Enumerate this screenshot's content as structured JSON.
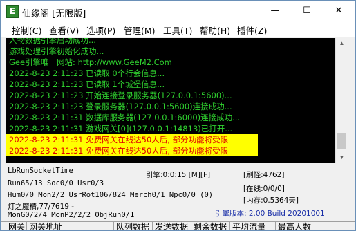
{
  "window": {
    "title": "仙缘阁 [无限版]",
    "icon_letter": "E"
  },
  "titlebar_buttons": {
    "minimize": "—",
    "maximize": "☐",
    "close": "✕"
  },
  "menu": [
    "控制(C)",
    "查看(V)",
    "选项(P)",
    "管理(M)",
    "工具(T)",
    "帮助(H)",
    "插件(Z)"
  ],
  "colors": {
    "green": "#2fd12f",
    "yellow_bg": "#ffff00",
    "red_text": "#e00000"
  },
  "log": [
    {
      "text": "人物数据引擎启动成功...",
      "style": "green"
    },
    {
      "text": "游戏处理引擎初始化成功...",
      "style": "green"
    },
    {
      "text": "Gee引擎唯一网站: http://www.GeeM2.Com",
      "style": "green"
    },
    {
      "text": "2022-8-23 2:11:23 已读取 0个行会信息...",
      "style": "green"
    },
    {
      "text": "2022-8-23 2:11:23 已读取 1个城堡信息...",
      "style": "green"
    },
    {
      "text": "2022-8-23 2:11:23 开始连接登录服务器(127.0.0.1:5600)...",
      "style": "green"
    },
    {
      "text": "2022-8-23 2:11:23 登录服务器(127.0.0.1:5600)连接成功...",
      "style": "green"
    },
    {
      "text": "2022-8-23 2:11:31 数据库服务器(127.0.0.1:6000)连接成功...",
      "style": "green"
    },
    {
      "text": "2022-8-23 2:11:31 游戏网关[0](127.0.0.1:14813)已打开...",
      "style": "green"
    },
    {
      "text": "2022-8-23 2:11:31 免费网关在线达50人后, 部分功能将受限",
      "style": "warn"
    },
    {
      "text": "2022-8-23 2:11:31 免费网关在线达50人后, 部分功能将受限",
      "style": "warn"
    }
  ],
  "status": {
    "socket": "LbRunSocketTime",
    "engine": "引擎:0:0:15 [M][F]",
    "brush": "[刷怪:4762]",
    "run": "Run65/13 Soc0/0 Usr0/3",
    "online": "[在线:0/0/0]",
    "hum": "Hum0/0 Mon2/2 UsrRot106/824 Merch0/1 Npc0/0 (0)",
    "mem": "[内存:0.5364天]",
    "map": "灯之魔精,77/7619 -",
    "mongo": "MonG0/2/4 MonP2/2/2 ObjRun0/1",
    "version": "引擎版本: 2.00 Build 20201001"
  },
  "table_headers": [
    "网关",
    "网关地址",
    "队列数据",
    "发送数据",
    "剩余数据",
    "平均流量",
    "最高人数"
  ]
}
